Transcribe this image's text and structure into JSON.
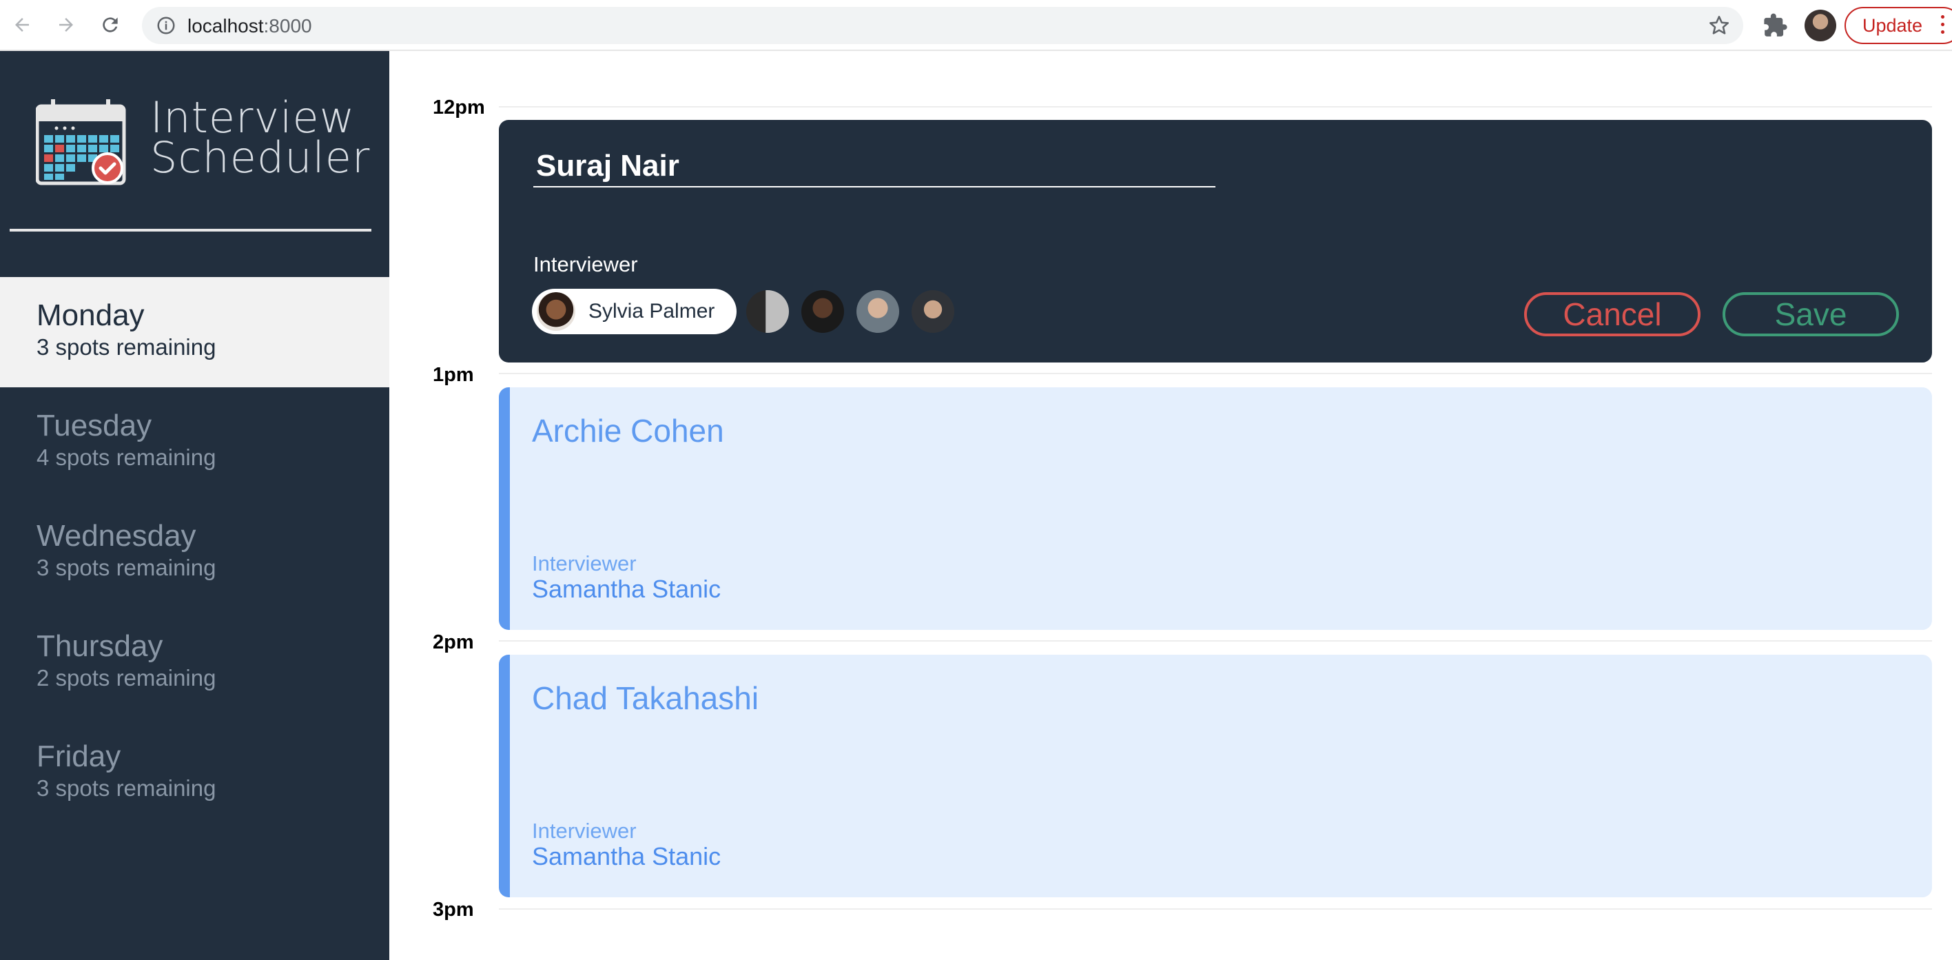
{
  "browser": {
    "url_host": "localhost",
    "url_port": ":8000",
    "update_label": "Update"
  },
  "sidebar": {
    "logo_line1": "Interview",
    "logo_line2": "Scheduler",
    "days": [
      {
        "name": "Monday",
        "spots": "3 spots remaining",
        "selected": true
      },
      {
        "name": "Tuesday",
        "spots": "4 spots remaining",
        "selected": false
      },
      {
        "name": "Wednesday",
        "spots": "3 spots remaining",
        "selected": false
      },
      {
        "name": "Thursday",
        "spots": "2 spots remaining",
        "selected": false
      },
      {
        "name": "Friday",
        "spots": "3 spots remaining",
        "selected": false
      }
    ]
  },
  "schedule": {
    "times": [
      "12pm",
      "1pm",
      "2pm",
      "3pm"
    ],
    "form": {
      "student_value": "Suraj Nair",
      "interviewer_label": "Interviewer",
      "selected_interviewer": "Sylvia Palmer",
      "cancel_label": "Cancel",
      "save_label": "Save"
    },
    "appointments": [
      {
        "student": "Archie Cohen",
        "label": "Interviewer",
        "interviewer": "Samantha Stanic"
      },
      {
        "student": "Chad Takahashi",
        "label": "Interviewer",
        "interviewer": "Samantha Stanic"
      }
    ]
  },
  "colors": {
    "sidebar_bg": "#222f3e",
    "appointment_bg": "#e4effd",
    "accent_blue": "#5e9af0",
    "cancel_red": "#d9534f",
    "save_green": "#3d9b77"
  }
}
